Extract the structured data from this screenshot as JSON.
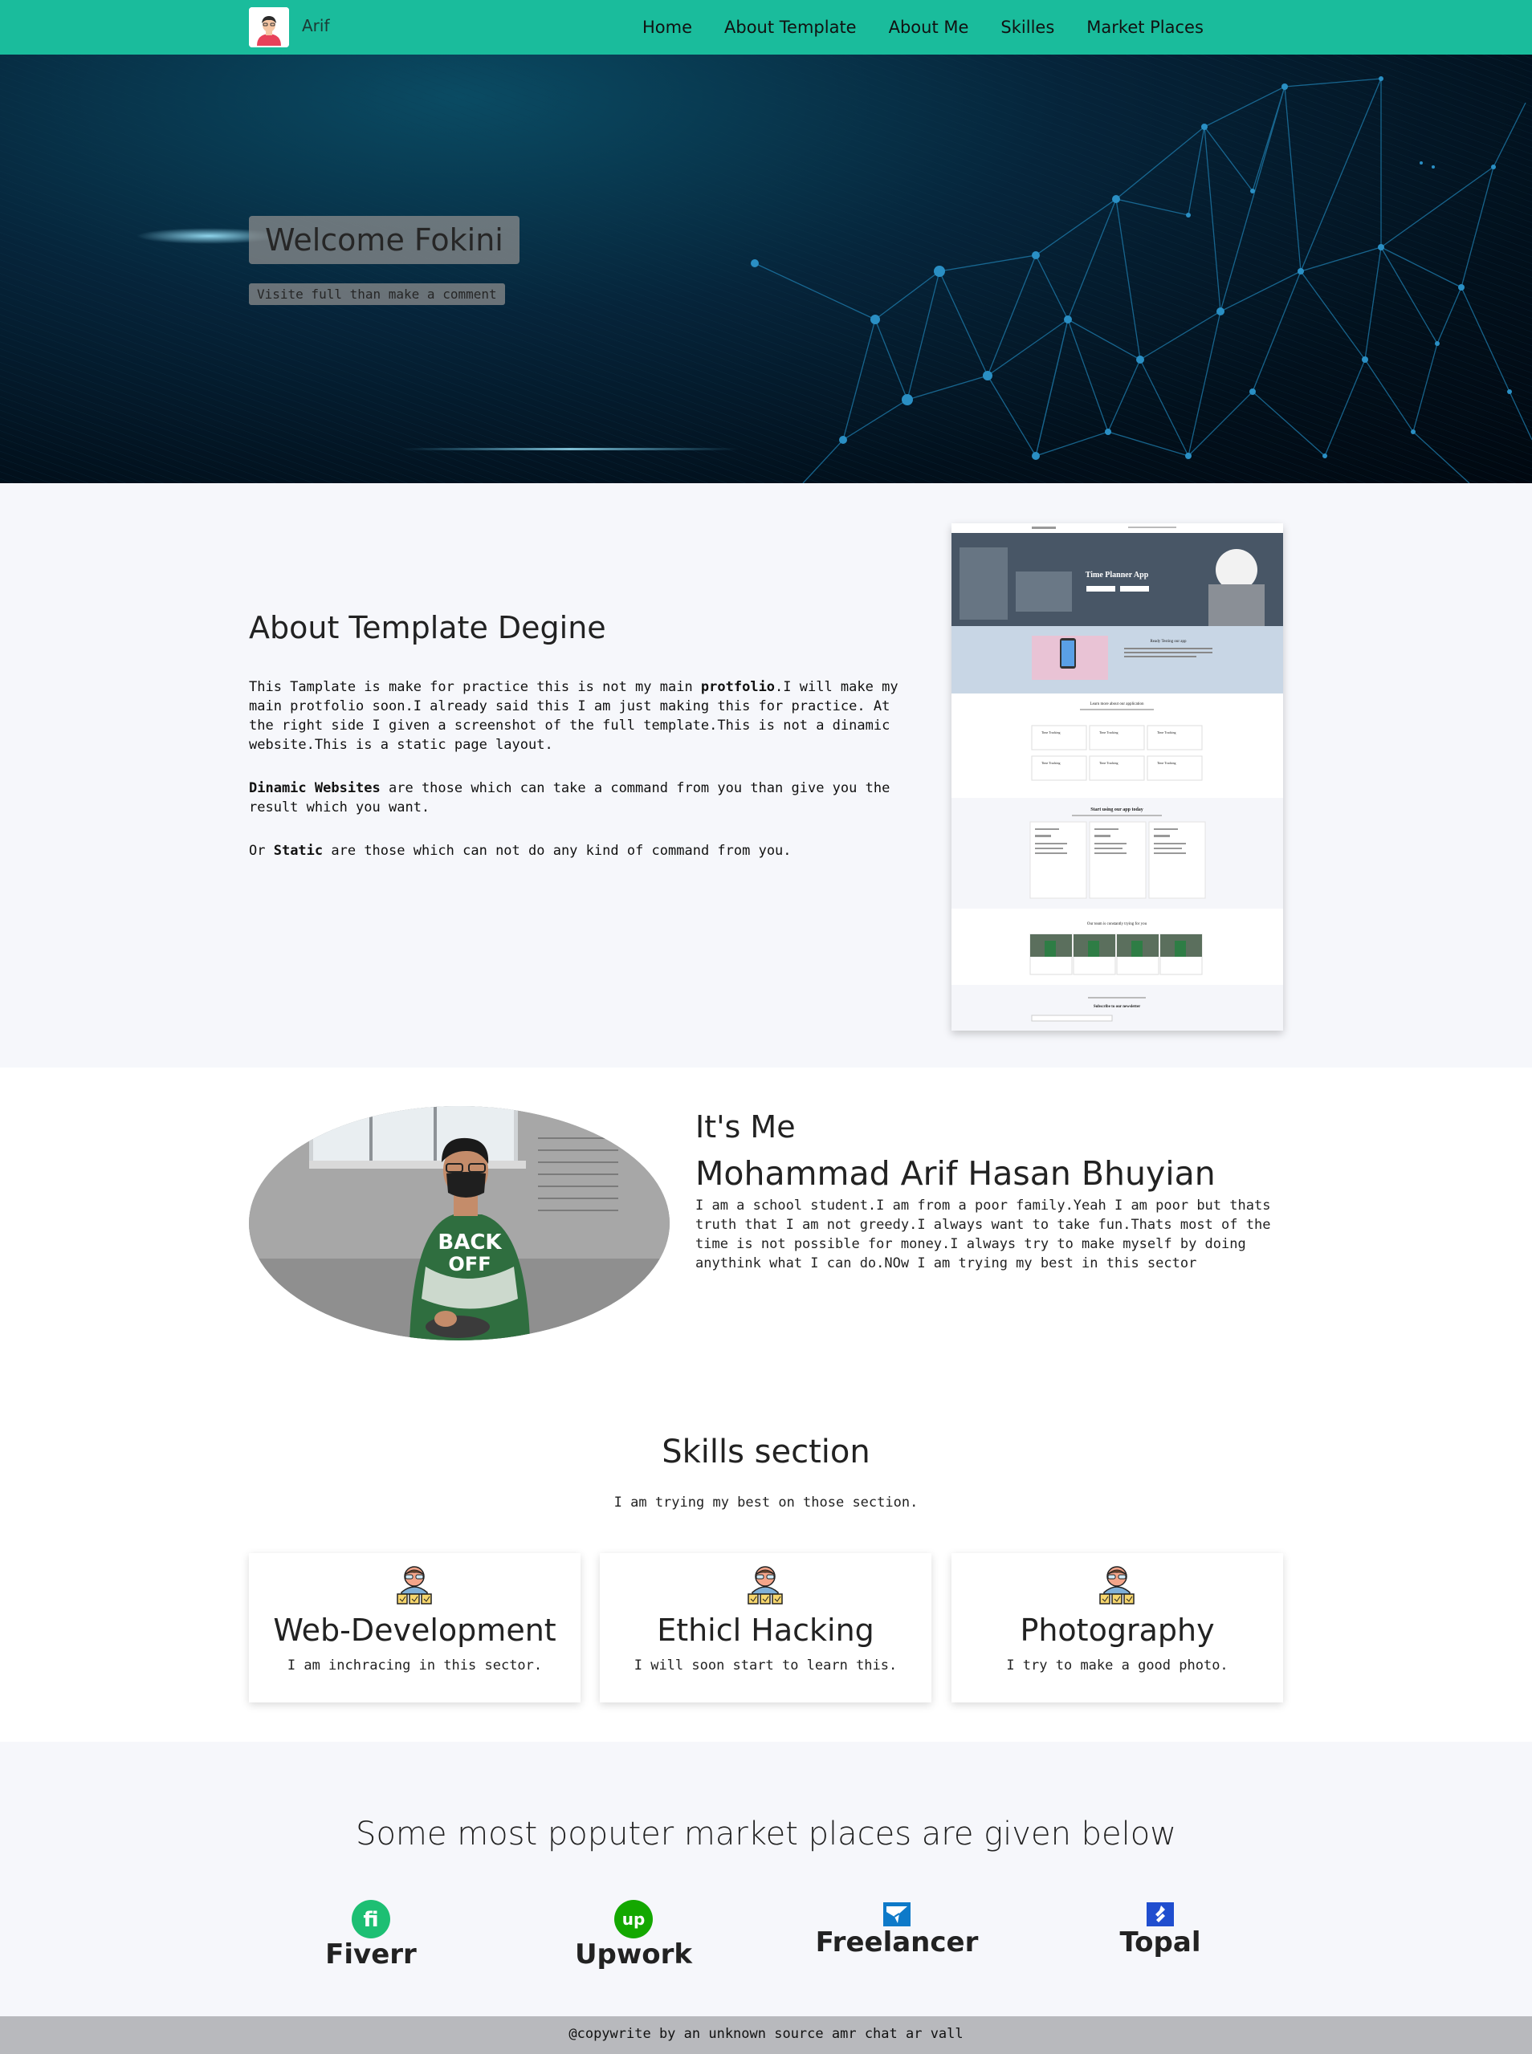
{
  "nav": {
    "brand": "Arif",
    "links": [
      "Home",
      "About Template",
      "About Me",
      "Skilles",
      "Market Places"
    ]
  },
  "hero": {
    "title": "Welcome Fokini",
    "subtitle": "Visite full than make a comment"
  },
  "about_template": {
    "heading": "About Template Degine",
    "p1_a": "This Tamplate is make for practice this is not my main ",
    "p1_b": "protfolio",
    "p1_c": ".I will make my main protfolio soon.I already said this I am just making this for practice. At the right side I given a screenshot of the full template.This is not a dinamic website.This is a static page layout.",
    "p2_a": "Dinamic Websites",
    "p2_b": " are those which can take a command from you than give you the result which you want.",
    "p3_a": "Or ",
    "p3_b": "Static",
    "p3_c": " are those which can not do any kind of command from you.",
    "screenshot": {
      "hero_title": "Time Planner App",
      "section_testing": "Ready Testing our app",
      "section_learn": "Learn more about our application",
      "card_label": "Time Tracking",
      "section_start": "Start using our app today",
      "section_team": "Our team is constantly trying for you",
      "section_subscribe": "Subscribe to our newsletter"
    }
  },
  "me": {
    "small": "It's Me",
    "name": "Mohammad Arif Hasan Bhuyian",
    "text": "I am a school student.I am from a poor family.Yeah I am poor but thats truth that I am not greedy.I always want to take fun.Thats most of the time is not possible for money.I always try to make myself by doing anythink what I can do.NOw I am trying my best in this sector",
    "shirt_text_1": "BACK",
    "shirt_text_2": "OFF"
  },
  "skills": {
    "title": "Skills section",
    "subtitle": "I am trying my best on those section.",
    "cards": [
      {
        "title": "Web-Development",
        "desc": "I am inchracing in this sector."
      },
      {
        "title": "Ethicl Hacking",
        "desc": "I will soon start to learn this."
      },
      {
        "title": "Photography",
        "desc": "I try to make a good photo."
      }
    ],
    "icon": "developer-icon"
  },
  "markets": {
    "title": "Some most poputer market places are given below",
    "items": [
      {
        "name": "Fiverr",
        "icon": "fiverr-icon",
        "glyph": "fi",
        "color": "#1dbf73"
      },
      {
        "name": "Upwork",
        "icon": "upwork-icon",
        "glyph": "up",
        "color": "#14a800"
      },
      {
        "name": "Freelancer",
        "icon": "freelancer-icon",
        "glyph": "",
        "color": "#0e7ac9"
      },
      {
        "name": "Topal",
        "icon": "toptal-icon",
        "glyph": "",
        "color": "#204ecf"
      }
    ]
  },
  "footer": {
    "text": "@copywrite by an unknown source amr chat ar vall"
  },
  "colors": {
    "accent": "#1abc9c",
    "section_bg": "#f6f7fb",
    "footer_bg": "#b8b9bd"
  }
}
